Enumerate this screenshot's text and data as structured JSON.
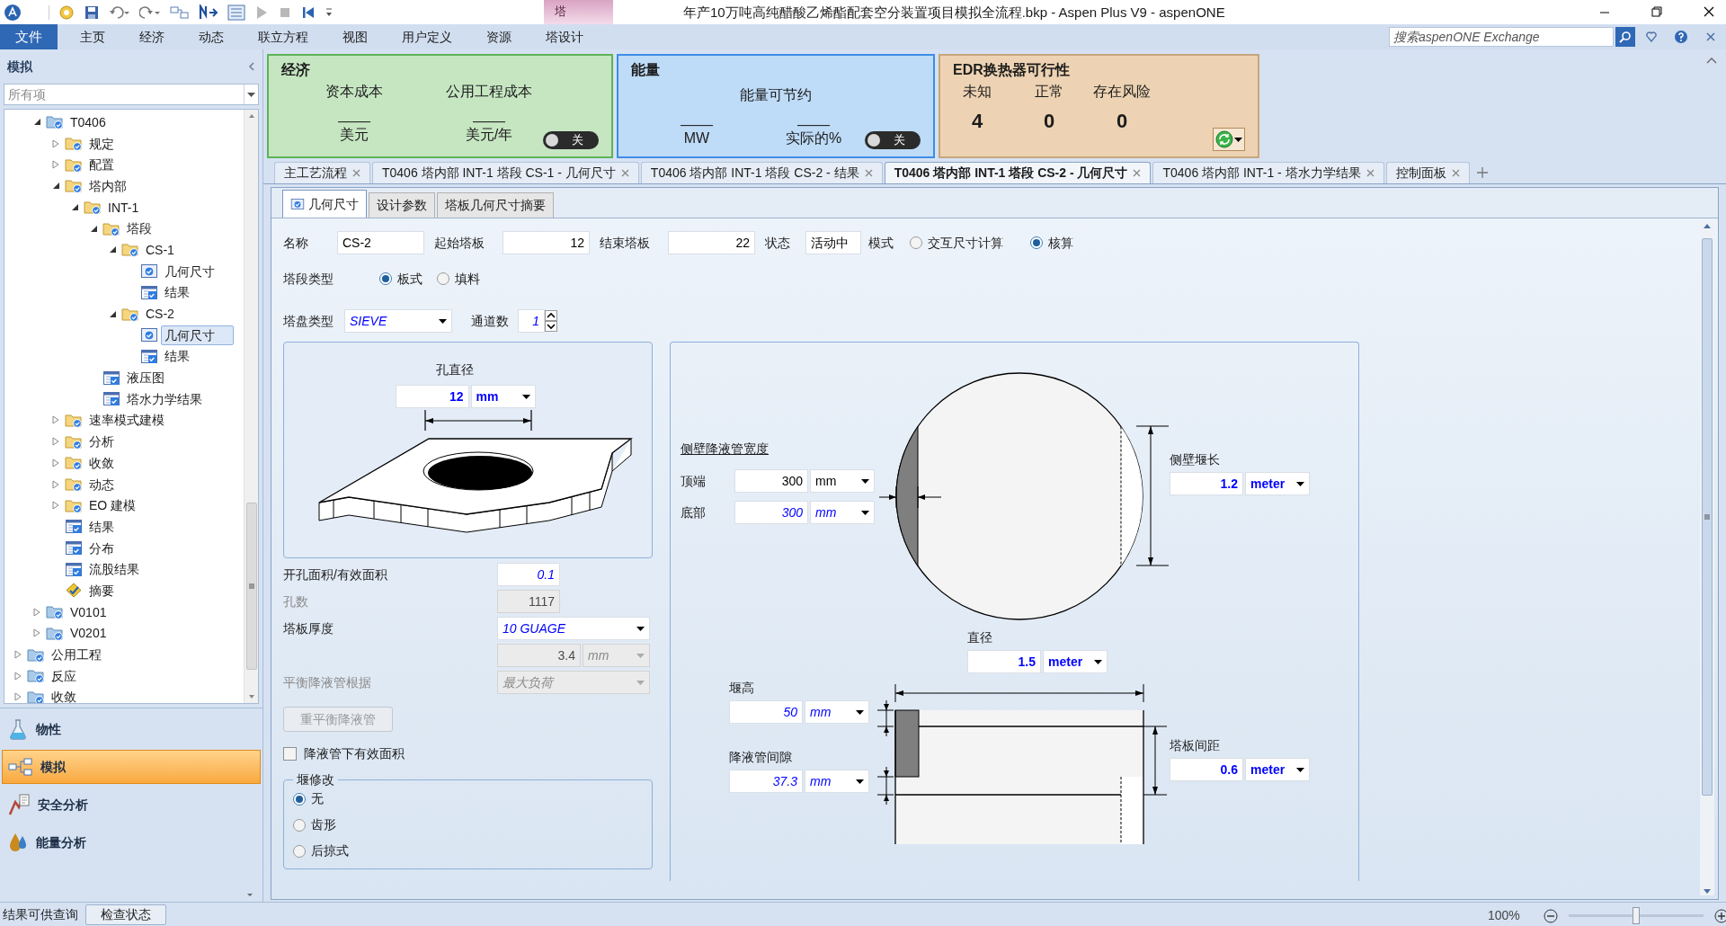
{
  "window": {
    "title": "年产10万吨高纯醋酸乙烯酯配套空分装置项目模拟全流程.bkp - Aspen Plus V9 - aspenONE",
    "context_tab": "塔"
  },
  "menu": {
    "file": "文件",
    "tabs": [
      {
        "label": "主页",
        "selected": false
      },
      {
        "label": "经济",
        "selected": false
      },
      {
        "label": "动态",
        "selected": false
      },
      {
        "label": "联立方程",
        "selected": false
      },
      {
        "label": "视图",
        "selected": false
      },
      {
        "label": "用户定义",
        "selected": false
      },
      {
        "label": "资源",
        "selected": false
      },
      {
        "label": "塔设计",
        "selected": false
      }
    ],
    "search": {
      "placeholder": "搜索aspenONE Exchange"
    }
  },
  "ribbon": {
    "economics": {
      "title": "经济",
      "items": [
        {
          "label": "资本成本",
          "value": "____",
          "unit": "美元"
        },
        {
          "label": "公用工程成本",
          "value": "____",
          "unit": "美元/年"
        }
      ],
      "toggle": {
        "label": "关",
        "on": false
      }
    },
    "energy": {
      "title": "能量",
      "caption": "能量可节约",
      "items": [
        {
          "value": "____",
          "unit": "MW"
        },
        {
          "value": "____",
          "unit": "实际的%"
        }
      ],
      "toggle": {
        "label": "关",
        "on": false
      }
    },
    "edr": {
      "title": "EDR换热器可行性",
      "items": [
        {
          "label": "未知",
          "count": "4"
        },
        {
          "label": "正常",
          "count": "0"
        },
        {
          "label": "存在风险",
          "count": "0"
        }
      ]
    }
  },
  "navigator": {
    "title": "模拟",
    "filter": "所有项",
    "scrolled_branch": [
      {
        "label": "T0406",
        "kind": "block",
        "expanded": true,
        "selected": false,
        "children": [
          {
            "label": "规定",
            "kind": "folder",
            "expanded": false,
            "selected": false
          },
          {
            "label": "配置",
            "kind": "folder",
            "expanded": false,
            "selected": false
          },
          {
            "label": "塔内部",
            "kind": "folder",
            "expanded": true,
            "selected": false,
            "children": [
              {
                "label": "INT-1",
                "kind": "folder",
                "expanded": true,
                "selected": false,
                "children": [
                  {
                    "label": "塔段",
                    "kind": "folder",
                    "expanded": true,
                    "selected": false,
                    "children": [
                      {
                        "label": "CS-1",
                        "kind": "folder",
                        "expanded": true,
                        "selected": false,
                        "children": [
                          {
                            "label": "几何尺寸",
                            "kind": "form",
                            "selected": false
                          },
                          {
                            "label": "结果",
                            "kind": "result",
                            "selected": false
                          }
                        ]
                      },
                      {
                        "label": "CS-2",
                        "kind": "folder",
                        "expanded": true,
                        "selected": false,
                        "children": [
                          {
                            "label": "几何尺寸",
                            "kind": "form",
                            "selected": true
                          },
                          {
                            "label": "结果",
                            "kind": "result",
                            "selected": false
                          }
                        ]
                      }
                    ]
                  },
                  {
                    "label": "液压图",
                    "kind": "result",
                    "selected": false
                  },
                  {
                    "label": "塔水力学结果",
                    "kind": "result",
                    "selected": false
                  }
                ]
              }
            ]
          },
          {
            "label": "速率模式建模",
            "kind": "folder",
            "expanded": false,
            "selected": false
          },
          {
            "label": "分析",
            "kind": "folder",
            "expanded": false,
            "selected": false
          },
          {
            "label": "收敛",
            "kind": "folder",
            "expanded": false,
            "selected": false
          },
          {
            "label": "动态",
            "kind": "folder",
            "expanded": false,
            "selected": false
          },
          {
            "label": "EO 建模",
            "kind": "folder",
            "expanded": false,
            "selected": false
          },
          {
            "label": "结果",
            "kind": "result",
            "selected": false
          },
          {
            "label": "分布",
            "kind": "result",
            "selected": false
          },
          {
            "label": "流股结果",
            "kind": "result",
            "selected": false
          },
          {
            "label": "摘要",
            "kind": "summary",
            "selected": false
          }
        ]
      },
      {
        "label": "V0101",
        "kind": "block",
        "expanded": false,
        "selected": false
      },
      {
        "label": "V0201",
        "kind": "block",
        "expanded": false,
        "selected": false
      }
    ],
    "items": [
      {
        "label": "公用工程",
        "kind": "block",
        "expanded": false,
        "selected": false
      },
      {
        "label": "反应",
        "kind": "block",
        "expanded": false,
        "selected": false
      },
      {
        "label": "收敛",
        "kind": "block",
        "expanded": false,
        "selected": false
      }
    ]
  },
  "nav_buttons": [
    {
      "label": "物性",
      "kind": "properties",
      "selected": false
    },
    {
      "label": "模拟",
      "kind": "simulation",
      "selected": true
    },
    {
      "label": "安全分析",
      "kind": "safety",
      "selected": false
    },
    {
      "label": "能量分析",
      "kind": "energy",
      "selected": false
    }
  ],
  "doc_tabs": [
    {
      "label": "主工艺流程",
      "selected": false
    },
    {
      "label": "T0406 塔内部 INT-1 塔段 CS-1 - 几何尺寸",
      "selected": false
    },
    {
      "label": "T0406 塔内部 INT-1 塔段 CS-2 - 结果",
      "selected": false
    },
    {
      "label": "T0406 塔内部 INT-1 塔段 CS-2 - 几何尺寸",
      "selected": true
    },
    {
      "label": "T0406 塔内部 INT-1 - 塔水力学结果",
      "selected": false
    },
    {
      "label": "控制面板",
      "selected": false
    }
  ],
  "form_tabs": [
    {
      "label": "几何尺寸",
      "selected": true,
      "complete": true
    },
    {
      "label": "设计参数",
      "selected": false,
      "complete": false
    },
    {
      "label": "塔板几何尺寸摘要",
      "selected": false,
      "complete": false
    }
  ],
  "form": {
    "name": {
      "label": "名称",
      "field": {
        "value": "CS-2",
        "kind": "plain"
      }
    },
    "start_stage": {
      "label": "起始塔板",
      "field": {
        "value": "12",
        "kind": "plain"
      }
    },
    "end_stage": {
      "label": "结束塔板",
      "field": {
        "value": "22",
        "kind": "plain"
      }
    },
    "status": {
      "label": "状态",
      "field": {
        "value": "活动中",
        "kind": "plain"
      }
    },
    "mode": {
      "label": "模式",
      "options": [
        {
          "label": "交互尺寸计算",
          "selected": false
        },
        {
          "label": "核算",
          "selected": true
        }
      ]
    },
    "section_type": {
      "label": "塔段类型",
      "options": [
        {
          "label": "板式",
          "selected": true
        },
        {
          "label": "填料",
          "selected": false
        }
      ]
    },
    "tray_type": {
      "label": "塔盘类型",
      "field": {
        "value": "SIEVE",
        "kind": "calculated"
      }
    },
    "passes": {
      "label": "通道数",
      "field": {
        "value": "1",
        "kind": "calculated"
      }
    },
    "hole_diameter": {
      "label": "孔直径",
      "field": {
        "value": "12",
        "kind": "entered"
      },
      "unit": {
        "value": "mm",
        "kind": "entered"
      }
    },
    "hole_area_ratio": {
      "label": "开孔面积/有效面积",
      "disabled": false,
      "field": {
        "value": "0.1",
        "kind": "calculated"
      }
    },
    "hole_count": {
      "label": "孔数",
      "disabled": true,
      "field": {
        "value": "1117",
        "kind": "disabled"
      }
    },
    "tray_thickness": {
      "label": "塔板厚度",
      "disabled": false,
      "field": {
        "value": "10 GUAGE",
        "kind": "calculated"
      },
      "thickness": {
        "value": "3.4",
        "kind": "disabled"
      },
      "unit": {
        "value": "mm",
        "kind": "disabled_calculated"
      }
    },
    "balance_basis": {
      "label": "平衡降液管根据",
      "disabled": true,
      "field": {
        "value": "最大负荷",
        "kind": "disabled_calculated"
      }
    },
    "rebalance_button": {
      "label": "重平衡降液管",
      "disabled": true
    },
    "active_area_under_dc": {
      "label": "降液管下有效面积",
      "checked": false
    },
    "weir_modification": {
      "title": "堰修改",
      "options": [
        {
          "label": "无",
          "selected": true
        },
        {
          "label": "齿形",
          "selected": false
        },
        {
          "label": "后掠式",
          "selected": false
        }
      ]
    },
    "side_dc_width": {
      "title": "侧壁降液管宽度",
      "rows": [
        {
          "label": "顶端",
          "field": {
            "value": "300",
            "kind": "plain"
          },
          "unit": {
            "value": "mm",
            "kind": "plain"
          }
        },
        {
          "label": "底部",
          "field": {
            "value": "300",
            "kind": "calculated"
          },
          "unit": {
            "value": "mm",
            "kind": "calculated"
          }
        }
      ]
    },
    "side_weir_length": {
      "label": "侧壁堰长",
      "field": {
        "value": "1.2",
        "kind": "entered"
      },
      "unit": {
        "value": "meter",
        "kind": "entered"
      }
    },
    "diameter": {
      "label": "直径",
      "field": {
        "value": "1.5",
        "kind": "entered"
      },
      "unit": {
        "value": "meter",
        "kind": "entered"
      }
    },
    "weir_height": {
      "label": "堰高",
      "field": {
        "value": "50",
        "kind": "calculated"
      },
      "unit": {
        "value": "mm",
        "kind": "calculated"
      }
    },
    "dc_clearance": {
      "label": "降液管间隙",
      "field": {
        "value": "37.3",
        "kind": "calculated"
      },
      "unit": {
        "value": "mm",
        "kind": "calculated"
      }
    },
    "tray_spacing": {
      "label": "塔板间距",
      "field": {
        "value": "0.6",
        "kind": "entered"
      },
      "unit": {
        "value": "meter",
        "kind": "entered"
      }
    }
  },
  "status_bar": {
    "message": "结果可供查询",
    "button": "检查状态",
    "zoom": "100%",
    "zoom_slider": {
      "level": 0.5
    }
  }
}
